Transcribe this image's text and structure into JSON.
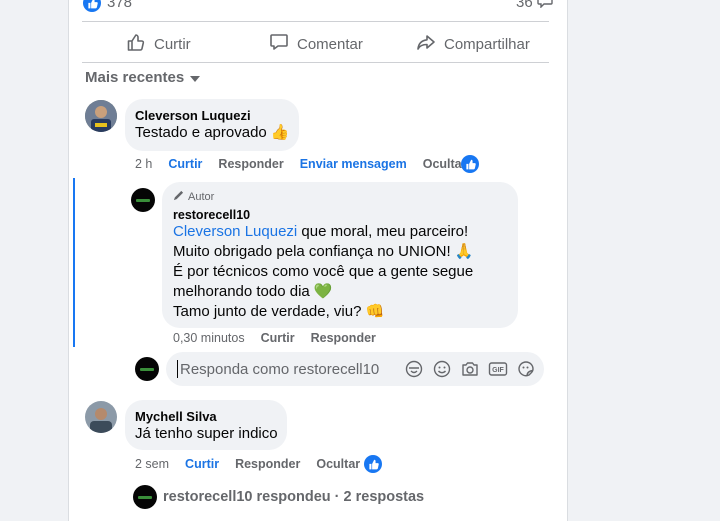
{
  "post": {
    "reactions_count": "378",
    "comments_count": "36",
    "actions": {
      "like": "Curtir",
      "comment": "Comentar",
      "share": "Compartilhar"
    },
    "sort_label": "Mais recentes"
  },
  "comments": [
    {
      "author": "Cleverson Luquezi",
      "text": "Testado e aprovado 👍",
      "time": "2 h",
      "like": "Curtir",
      "reply": "Responder",
      "message": "Enviar mensagem",
      "hide": "Ocultar",
      "reply_entry": {
        "badge": "Autor",
        "author": "restorecell10",
        "mention": "Cleverson Luquezi",
        "line1_rest": " que moral, meu parceiro!",
        "line2": "Muito obrigado pela confiança no UNION! 🙏",
        "line3": "É por técnicos como você que a gente segue",
        "line4": "melhorando todo dia 💚",
        "line5": "Tamo junto de verdade, viu? 👊",
        "time": "0,30 minutos",
        "like": "Curtir",
        "reply": "Responder"
      },
      "reply_box": {
        "placeholder": "Responda como restorecell10"
      }
    },
    {
      "author": "Mychell Silva",
      "text": "Já tenho super indico",
      "time": "2 sem",
      "like": "Curtir",
      "reply": "Responder",
      "hide": "Ocultar",
      "replies_summary": "restorecell10 respondeu · 2 respostas"
    }
  ],
  "colors": {
    "accent": "#1877f2",
    "link": "#1b74e4",
    "bubble": "#f0f2f5"
  }
}
